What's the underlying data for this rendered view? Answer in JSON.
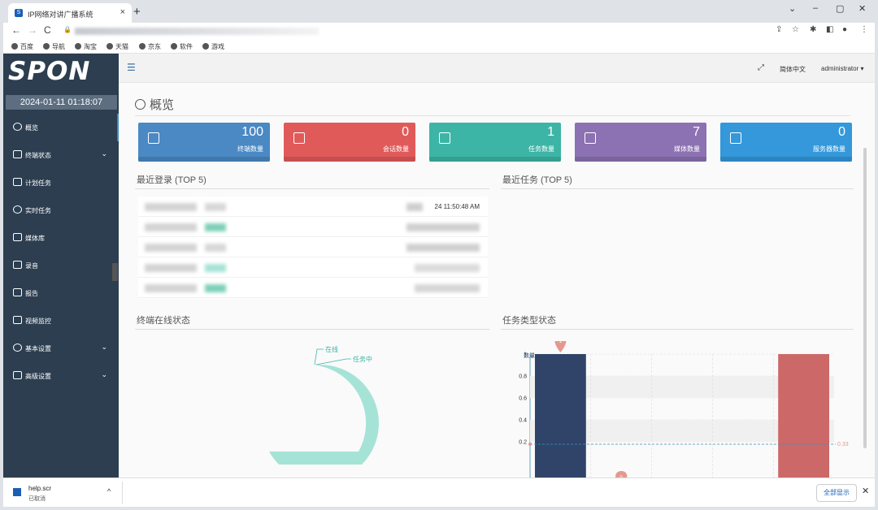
{
  "browser": {
    "tab_title": "IP网络对讲广播系统",
    "tab_close": "×",
    "new_tab": "+",
    "window_controls": [
      "⌄",
      "–",
      "▢",
      "✕"
    ],
    "nav": [
      "←",
      "→",
      "C"
    ],
    "lock": "🔒",
    "bookmarks": [
      "百度",
      "导航",
      "淘宝",
      "天猫",
      "京东",
      "软件",
      "游戏"
    ]
  },
  "app": {
    "logo": "SPON",
    "clock": "2024-01-11 01:18:07",
    "menu": [
      {
        "label": "概览",
        "chevron": false
      },
      {
        "label": "终端状态",
        "chevron": true
      },
      {
        "label": "计划任务",
        "chevron": false
      },
      {
        "label": "实时任务",
        "chevron": false
      },
      {
        "label": "媒体库",
        "chevron": false
      },
      {
        "label": "录音",
        "chevron": false
      },
      {
        "label": "报告",
        "chevron": false
      },
      {
        "label": "视频监控",
        "chevron": false
      },
      {
        "label": "基本设置",
        "chevron": true
      },
      {
        "label": "高级设置",
        "chevron": true
      }
    ],
    "menu_chevron": "⌄",
    "topbar": {
      "hamburger": "☰",
      "expand": "⤢",
      "language": "简体中文",
      "user": "administrator ▾"
    }
  },
  "overview": {
    "title": "概览",
    "stats": [
      {
        "value": "100",
        "label": "终端数量",
        "color": "#4a89c4"
      },
      {
        "value": "0",
        "label": "会话数量",
        "color": "#e15a5a"
      },
      {
        "value": "1",
        "label": "任务数量",
        "color": "#3db5a6"
      },
      {
        "value": "7",
        "label": "媒体数量",
        "color": "#8c72b2"
      },
      {
        "value": "0",
        "label": "服务器数量",
        "color": "#3498db"
      }
    ],
    "recent_login_title": "最近登录 (TOP 5)",
    "recent_task_title": "最近任务 (TOP 5)",
    "recent_login_time": "24 11:50:48 AM",
    "terminal_status_title": "终端在线状态",
    "task_type_title": "任务类型状态"
  },
  "chart_data": [
    {
      "type": "pie",
      "title": "终端在线状态",
      "labels": [
        "在线",
        "任务中"
      ],
      "colors": [
        "#a6e3d7",
        "#a6e3d7"
      ]
    },
    {
      "type": "bar",
      "title": "任务类型状态",
      "ylabel": "数量",
      "ylim": [
        0,
        1
      ],
      "yticks": [
        "1",
        "0.8",
        "0.6",
        "0.4",
        "0.2"
      ],
      "values": [
        1,
        0,
        0,
        0,
        1
      ],
      "colors": [
        "#2f4468",
        "#2f4468",
        "#2f4468",
        "#2f4468",
        "#cd6868"
      ],
      "markers": [
        "1",
        "0"
      ],
      "average_line": "0.33"
    }
  ],
  "downloads": {
    "file": "help.scr",
    "status": "已取消",
    "chevron": "^",
    "show_all": "全部显示",
    "close": "✕"
  }
}
